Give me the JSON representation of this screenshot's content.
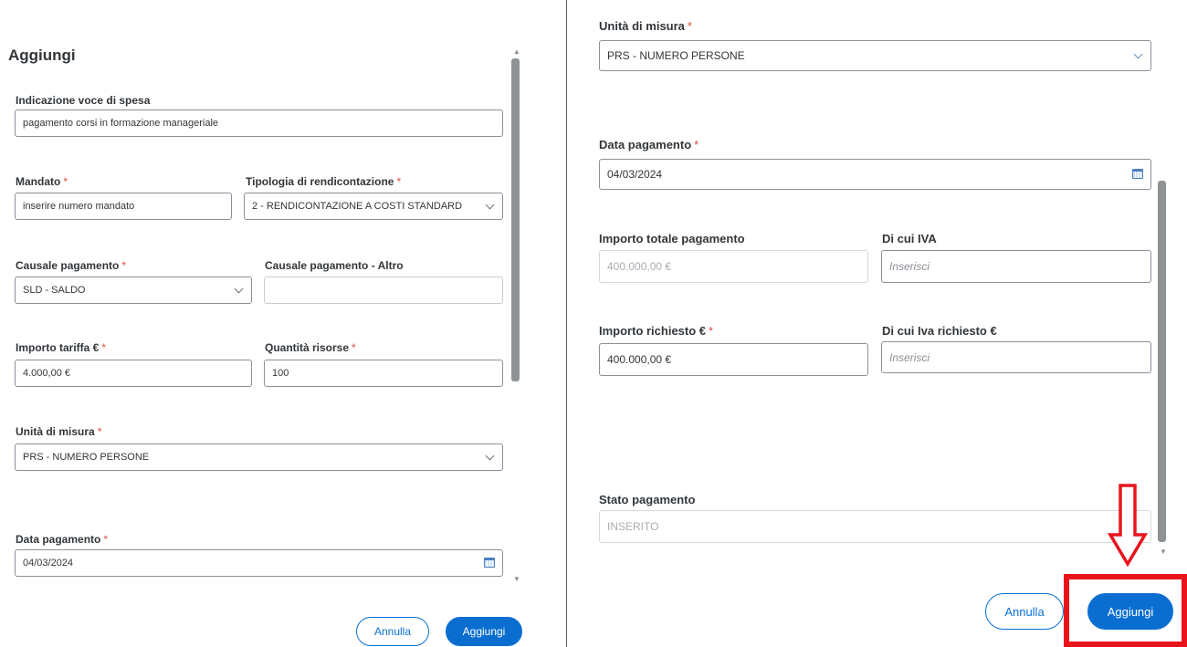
{
  "left": {
    "title": "Aggiungi",
    "voce_spesa": {
      "label": "Indicazione voce di spesa",
      "value": "pagamento corsi in formazione manageriale"
    },
    "mandato": {
      "label": "Mandato",
      "value": "inserire numero mandato"
    },
    "tipologia": {
      "label": "Tipologia di rendicontazione",
      "value": "2 - RENDICONTAZIONE A COSTI STANDARD"
    },
    "causale": {
      "label": "Causale pagamento",
      "value": "SLD - SALDO"
    },
    "causale_altro": {
      "label": "Causale pagamento - Altro",
      "value": ""
    },
    "importo_tariffa": {
      "label": "Importo tariffa €",
      "value": "4.000,00 €"
    },
    "quantita": {
      "label": "Quantità risorse",
      "value": "100"
    },
    "unita": {
      "label": "Unità di misura",
      "value": "PRS - NUMERO PERSONE"
    },
    "data": {
      "label": "Data pagamento",
      "value": "04/03/2024"
    },
    "buttons": {
      "cancel": "Annulla",
      "add": "Aggiungi"
    }
  },
  "right": {
    "unita": {
      "label": "Unità di misura",
      "value": "PRS - NUMERO PERSONE"
    },
    "data": {
      "label": "Data pagamento",
      "value": "04/03/2024"
    },
    "importo_totale": {
      "label": "Importo totale pagamento",
      "value": "400.000,00 €"
    },
    "iva": {
      "label": "Di cui IVA",
      "placeholder": "Inserisci"
    },
    "importo_richiesto": {
      "label": "Importo richiesto €",
      "value": "400.000,00 €"
    },
    "iva_richiesto": {
      "label": "Di cui Iva richiesto €",
      "placeholder": "Inserisci"
    },
    "stato": {
      "label": "Stato pagamento",
      "value": "INSERITO"
    },
    "buttons": {
      "cancel": "Annulla",
      "add": "Aggiungi"
    }
  },
  "colors": {
    "accent": "#0a6ed1",
    "required": "#e34a3c",
    "highlight": "#e8141c"
  },
  "required_mark": "*",
  "icons": {
    "dropdown": "chevron-down-icon",
    "date": "calendar-icon",
    "callout": "arrow-down-icon"
  }
}
